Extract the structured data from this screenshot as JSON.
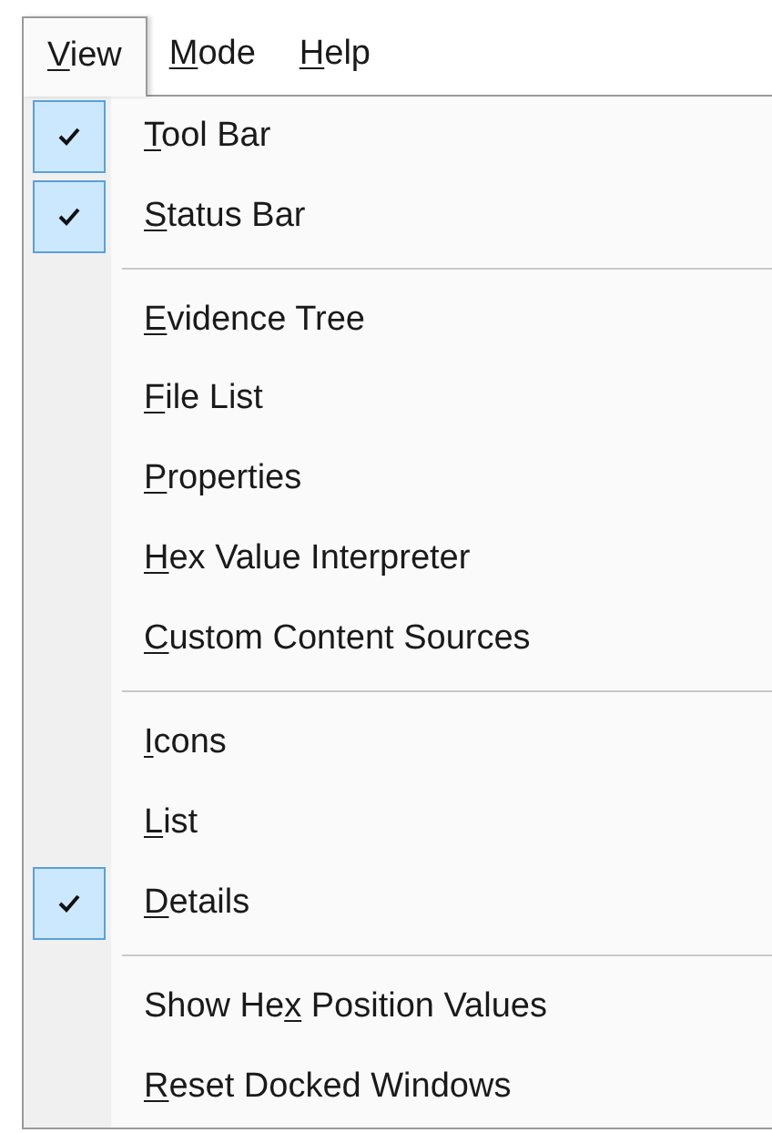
{
  "menu_bar": [
    {
      "key": "V",
      "post": "iew",
      "selected": true
    },
    {
      "key": "M",
      "post": "ode",
      "selected": false
    },
    {
      "key": "H",
      "post": "elp",
      "selected": false
    }
  ],
  "menu": [
    {
      "kind": "item",
      "key": "T",
      "post": "ool Bar",
      "checked": true
    },
    {
      "kind": "item",
      "key": "S",
      "post": "tatus Bar",
      "checked": true
    },
    {
      "kind": "separator"
    },
    {
      "kind": "item",
      "key": "E",
      "post": "vidence Tree",
      "checked": false
    },
    {
      "kind": "item",
      "key": "F",
      "post": "ile List",
      "checked": false
    },
    {
      "kind": "item",
      "key": "P",
      "post": "roperties",
      "checked": false
    },
    {
      "kind": "item",
      "key": "H",
      "post": "ex Value Interpreter",
      "checked": false
    },
    {
      "kind": "item",
      "key": "C",
      "post": "ustom Content Sources",
      "checked": false
    },
    {
      "kind": "separator"
    },
    {
      "kind": "item",
      "key": "I",
      "post": "cons",
      "checked": false
    },
    {
      "kind": "item",
      "key": "L",
      "post": "ist",
      "checked": false
    },
    {
      "kind": "item",
      "key": "D",
      "post": "etails",
      "checked": true
    },
    {
      "kind": "separator"
    },
    {
      "kind": "item",
      "pre": "Show He",
      "key": "x",
      "post": " Position Values",
      "checked": false
    },
    {
      "kind": "item",
      "key": "R",
      "post": "eset Docked Windows",
      "checked": false
    }
  ]
}
